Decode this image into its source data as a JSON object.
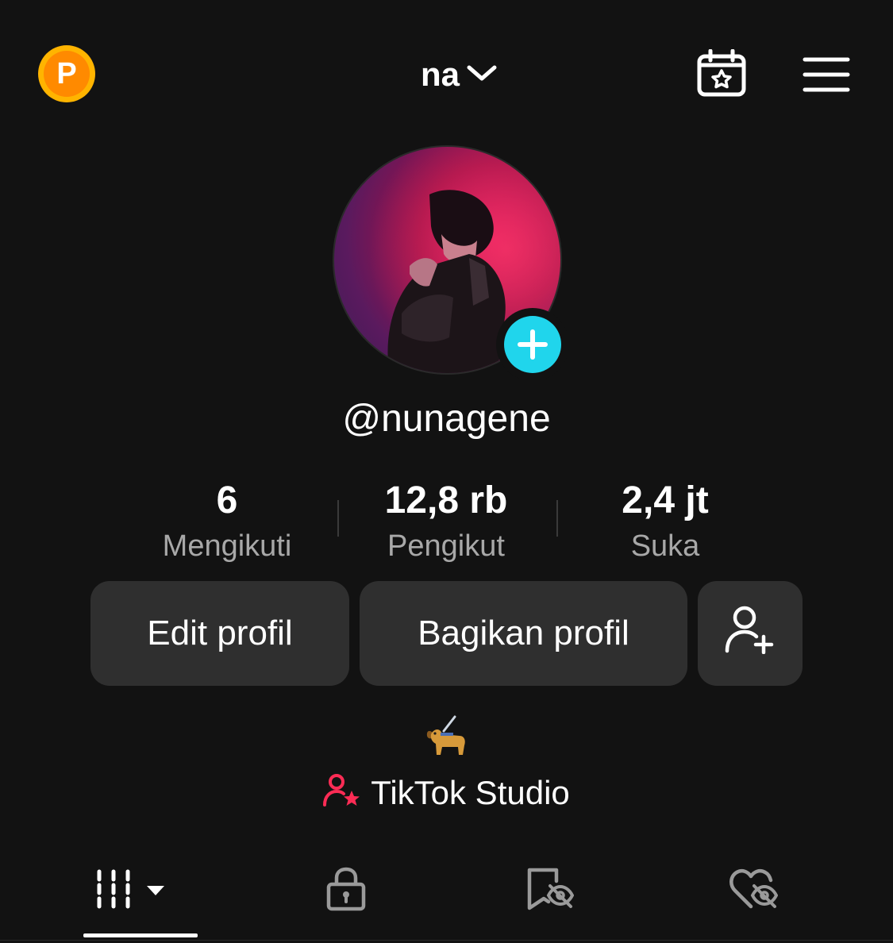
{
  "header": {
    "coin_letter": "P",
    "account_name": "na",
    "icons": {
      "coin": "coin-icon",
      "account_dropdown": "chevron-down-icon",
      "calendar": "calendar-star-icon",
      "menu": "hamburger-menu-icon"
    }
  },
  "profile": {
    "handle": "@nunagene",
    "avatar_add_icon": "plus-icon"
  },
  "stats": [
    {
      "value": "6",
      "label": "Mengikuti"
    },
    {
      "value": "12,8 rb",
      "label": "Pengikut"
    },
    {
      "value": "2,4 jt",
      "label": "Suka"
    }
  ],
  "actions": {
    "edit_label": "Edit profil",
    "share_label": "Bagikan profil",
    "add_friend_icon": "add-user-icon"
  },
  "bio": {
    "emoji_icon": "guide-dog-icon"
  },
  "studio": {
    "label": "TikTok Studio",
    "icon": "creator-star-icon"
  },
  "tabs": [
    {
      "name": "videos",
      "icon": "grid-icon",
      "selected": true
    },
    {
      "name": "private",
      "icon": "lock-icon",
      "selected": false
    },
    {
      "name": "saved",
      "icon": "bookmark-hidden-icon",
      "selected": false
    },
    {
      "name": "liked",
      "icon": "heart-hidden-icon",
      "selected": false
    }
  ],
  "colors": {
    "background": "#121212",
    "accent_cyan": "#20d5ec",
    "accent_red": "#fe2c55",
    "coin_gold": "#ffb400",
    "button_bg": "#2f2f2f",
    "muted_text": "#a8a8a8"
  }
}
